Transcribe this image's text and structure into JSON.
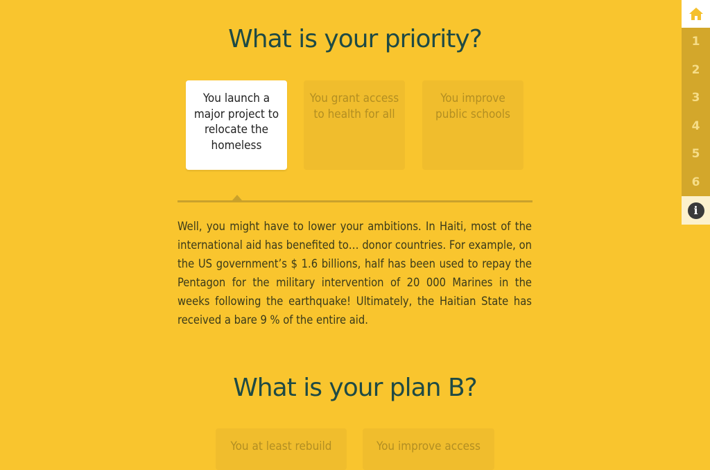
{
  "section1": {
    "title": "What is your priority?",
    "choices": [
      {
        "label": "You launch a major project to relocate the homeless",
        "selected": true
      },
      {
        "label": "You grant access to health for all",
        "selected": false
      },
      {
        "label": "You improve public schools",
        "selected": false
      }
    ],
    "answer": "Well, you might have to lower your ambitions. In Haiti, most of the international aid has benefited to… donor countries. For example, on the US government’s $ 1.6 billions, half has been used to repay the Pentagon for the military intervention of 20 000 Marines in the weeks following the earthquake! Ultimately, the Haitian State has received a bare 9 % of the entire aid."
  },
  "section2": {
    "title": "What is your plan B?",
    "choices": [
      {
        "label": "You at least rebuild"
      },
      {
        "label": "You improve access"
      }
    ]
  },
  "sidebar": {
    "home_icon": "home-icon",
    "items": [
      "1",
      "2",
      "3",
      "4",
      "5",
      "6"
    ],
    "info_icon": "info-icon",
    "info_glyph": "i"
  },
  "colors": {
    "background": "#f9c52e",
    "title": "#1e4a45",
    "nav_active": "#ffffff",
    "nav_dark": "#d3a72b"
  }
}
